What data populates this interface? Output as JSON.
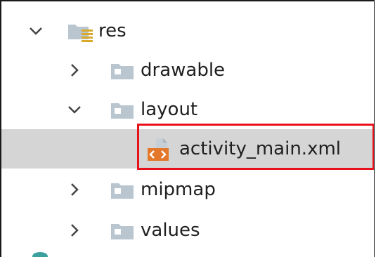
{
  "tree": {
    "items": [
      {
        "label": "res",
        "expanded": true,
        "icon": "resource-folder-icon"
      },
      {
        "label": "drawable",
        "expanded": false,
        "icon": "folder-icon"
      },
      {
        "label": "layout",
        "expanded": true,
        "icon": "folder-icon"
      },
      {
        "label": "activity_main.xml",
        "icon": "xml-file-icon",
        "selected": true
      },
      {
        "label": "mipmap",
        "expanded": false,
        "icon": "folder-icon"
      },
      {
        "label": "values",
        "expanded": false,
        "icon": "folder-icon"
      }
    ]
  },
  "colors": {
    "selection": "#d5d5d5",
    "highlight": "#e8111b",
    "folder": "#b9c6d0",
    "xml_orange": "#e3782a"
  }
}
